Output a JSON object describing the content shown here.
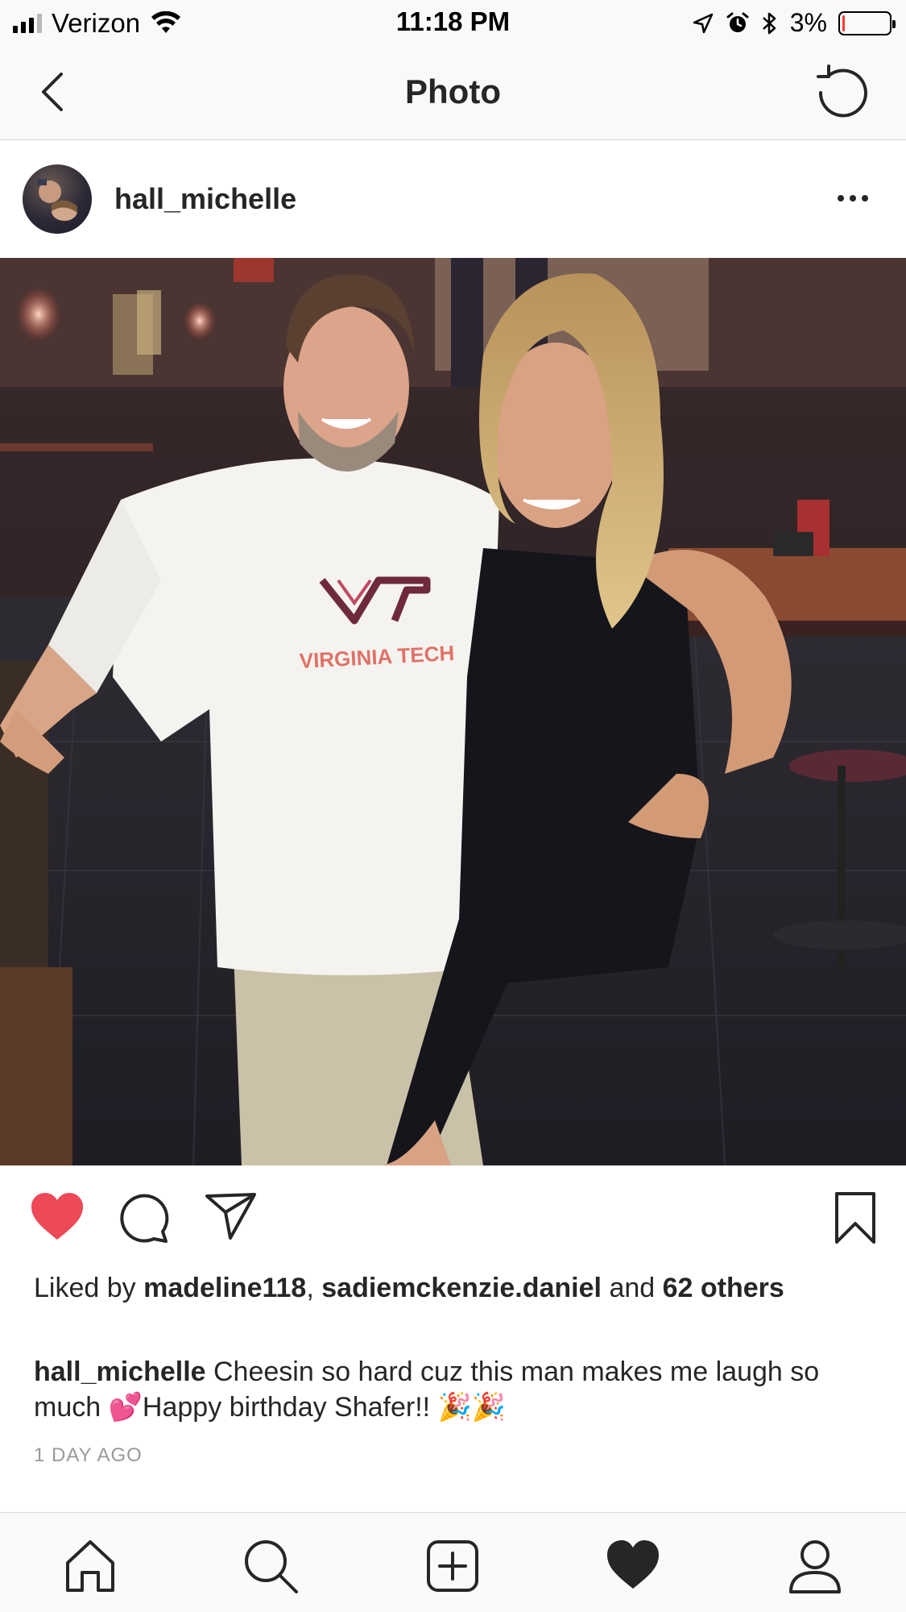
{
  "status_bar": {
    "carrier": "Verizon",
    "time": "11:18 PM",
    "battery_percent": "3%",
    "battery_level": 0.03,
    "icons": [
      "signal-icon",
      "wifi-icon",
      "location-icon",
      "alarm-icon",
      "bluetooth-icon",
      "battery-icon"
    ]
  },
  "header": {
    "title": "Photo",
    "icons": [
      "back-chevron-icon",
      "refresh-icon"
    ]
  },
  "post": {
    "username": "hall_michelle",
    "shirt_text": "VIRGINIA TECH",
    "shirt_logo": "VT",
    "likes": {
      "prefix": "Liked by",
      "user1": "madeline118",
      "separator": ",",
      "user2": "sadiemckenzie.daniel",
      "and_text": "and",
      "others": "62 others"
    },
    "caption": {
      "username": "hall_michelle",
      "text": "Cheesin so hard cuz this man makes me laugh so much 💕Happy birthday Shafer!! 🎉🎉"
    },
    "timestamp": "1 DAY AGO",
    "liked": true,
    "action_icons": [
      "heart-filled-icon",
      "comment-icon",
      "share-icon",
      "bookmark-icon"
    ]
  },
  "tab_bar": {
    "icons": [
      "home-icon",
      "search-icon",
      "add-post-icon",
      "activity-heart-icon",
      "profile-icon"
    ]
  },
  "colors": {
    "like_red": "#ed4956",
    "text": "#262626",
    "muted": "#999999",
    "battery_low": "#ff3b30",
    "vt_maroon": "#6e2a3c",
    "vt_orange": "#e5751f"
  }
}
